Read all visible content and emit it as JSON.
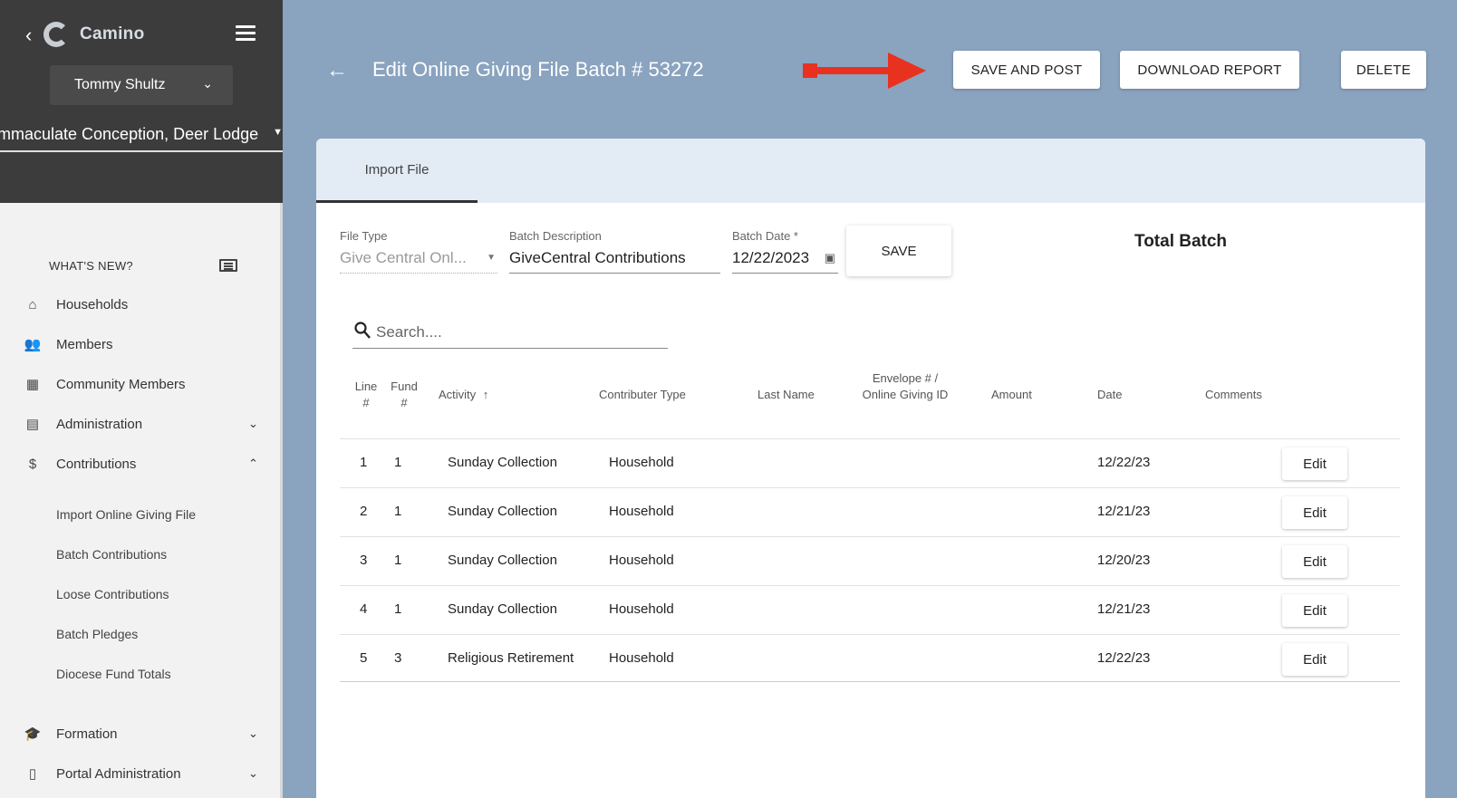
{
  "sidebar": {
    "app_name": "Camino",
    "user_name": "Tommy Shultz",
    "parish": "Immaculate Conception, Deer Lodge",
    "whats_new": "WHAT'S NEW?",
    "nav": [
      {
        "label": "Households",
        "icon": "home-icon"
      },
      {
        "label": "Members",
        "icon": "people-icon"
      },
      {
        "label": "Community Members",
        "icon": "building-icon"
      },
      {
        "label": "Administration",
        "icon": "grid-icon"
      },
      {
        "label": "Contributions",
        "icon": "dollar-icon"
      }
    ],
    "contributions_sub": [
      "Import Online Giving File",
      "Batch Contributions",
      "Loose Contributions",
      "Batch Pledges",
      "Diocese Fund Totals"
    ],
    "bottom_nav": [
      {
        "label": "Formation",
        "icon": "graduation-cap-icon"
      },
      {
        "label": "Portal Administration",
        "icon": "door-icon"
      }
    ]
  },
  "header": {
    "title": "Edit Online Giving File Batch # 53272",
    "save_and_post": "SAVE AND POST",
    "download_report": "DOWNLOAD REPORT",
    "delete": "DELETE"
  },
  "tabs": [
    {
      "label": "Import File"
    }
  ],
  "form": {
    "file_type_label": "File Type",
    "file_type_value": "Give Central Onl...",
    "batch_desc_label": "Batch Description",
    "batch_desc_value": "GiveCentral Contributions",
    "batch_date_label": "Batch Date *",
    "batch_date_value": "12/22/2023",
    "save": "SAVE",
    "total_batch": "Total Batch"
  },
  "search": {
    "placeholder": "Search...."
  },
  "table": {
    "headers": {
      "line": "Line #",
      "fund": "Fund #",
      "activity": "Activity",
      "contributor_type": "Contributer Type",
      "last_name": "Last Name",
      "envelope": "Envelope # / Online Giving ID",
      "amount": "Amount",
      "date": "Date",
      "comments": "Comments"
    },
    "edit_label": "Edit",
    "rows": [
      {
        "line": "1",
        "fund": "1",
        "activity": "Sunday Collection",
        "type": "Household",
        "date": "12/22/23"
      },
      {
        "line": "2",
        "fund": "1",
        "activity": "Sunday Collection",
        "type": "Household",
        "date": "12/21/23"
      },
      {
        "line": "3",
        "fund": "1",
        "activity": "Sunday Collection",
        "type": "Household",
        "date": "12/20/23"
      },
      {
        "line": "4",
        "fund": "1",
        "activity": "Sunday Collection",
        "type": "Household",
        "date": "12/21/23"
      },
      {
        "line": "5",
        "fund": "3",
        "activity": "Religious Retirement",
        "type": "Household",
        "date": "12/22/23"
      }
    ]
  },
  "colors": {
    "header_bg": "#8aa3bf",
    "sidebar_dark": "#3c3c3c",
    "annotation_arrow": "#e8321f"
  }
}
